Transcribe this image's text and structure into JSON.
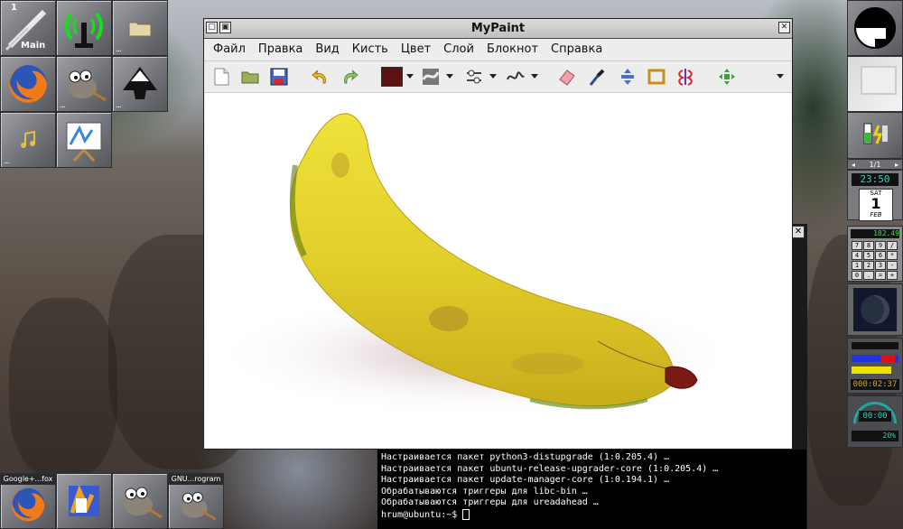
{
  "clip": {
    "workspace_number": "1",
    "workspace_name": "Main"
  },
  "mypaint": {
    "title": "MyPaint",
    "menu": [
      "Файл",
      "Правка",
      "Вид",
      "Кисть",
      "Цвет",
      "Слой",
      "Блокнот",
      "Справка"
    ],
    "icons": [
      "new-document-icon",
      "open-folder-icon",
      "save-icon",
      "undo-icon",
      "redo-icon",
      "color-swatch-icon",
      "brush-icon",
      "brush-modifiers-icon",
      "line-mode-icon",
      "eraser-icon",
      "color-picker-icon",
      "pan-icon",
      "frame-icon",
      "symmetry-icon",
      "view-icon"
    ],
    "active_color": "#5a1212"
  },
  "launchers_bottom": [
    {
      "label": "Google+...fox"
    },
    {
      "label": ""
    },
    {
      "label": ""
    },
    {
      "label": "GNU...rogram"
    }
  ],
  "dock": {
    "pager": "1/1",
    "clock_time": "23:50",
    "day": "SAT",
    "date": "1",
    "month": "FEB",
    "net_rate": "182.49",
    "calc_keys": [
      "7",
      "8",
      "9",
      "/",
      "4",
      "5",
      "6",
      "*",
      "1",
      "2",
      "3",
      "-",
      "0",
      ".",
      "=",
      "+"
    ],
    "timer": "000:02:37",
    "meter_time": "00:00",
    "meter_pct": "20%"
  },
  "terminal": {
    "lines": [
      "Настраивается пакет python3-distupgrade (1:0.205.4) …",
      "Настраивается пакет ubuntu-release-upgrader-core (1:0.205.4) …",
      "Настраивается пакет update-manager-core (1:0.194.1) …",
      "Обрабатываются триггеры для libc-bin …",
      "Обрабатываются триггеры для ureadahead …"
    ],
    "prompt": "hrum@ubuntu:~$ "
  }
}
